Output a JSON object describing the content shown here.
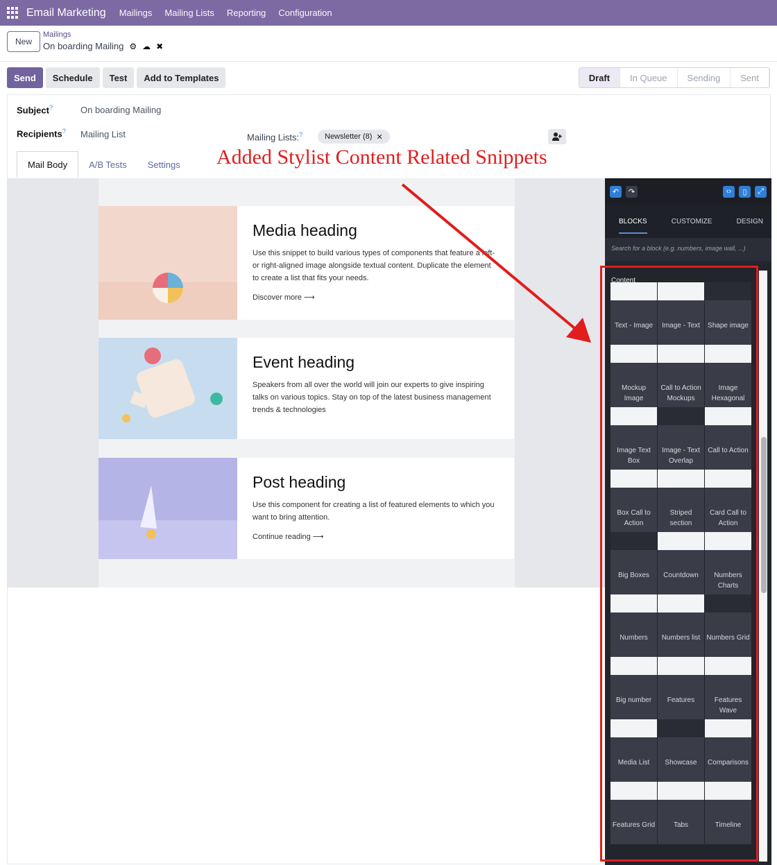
{
  "topnav": {
    "app_title": "Email Marketing",
    "items": [
      "Mailings",
      "Mailing Lists",
      "Reporting",
      "Configuration"
    ]
  },
  "control_panel": {
    "new_label": "New",
    "breadcrumb_parent": "Mailings",
    "breadcrumb_current": "On boarding Mailing",
    "gear_icon": "⚙",
    "upload_icon": "☁",
    "discard_icon": "✖"
  },
  "actions": {
    "send": "Send",
    "schedule": "Schedule",
    "test": "Test",
    "add_to_templates": "Add to Templates"
  },
  "stages": [
    "Draft",
    "In Queue",
    "Sending",
    "Sent"
  ],
  "form": {
    "subject_label": "Subject",
    "subject_value": "On boarding Mailing",
    "recipients_label": "Recipients",
    "recipients_value": "Mailing List",
    "mailing_lists_label": "Mailing Lists:",
    "help_mark": "?",
    "newsletter_tag": "Newsletter (8)",
    "tag_remove": "✕"
  },
  "tabs": [
    "Mail Body",
    "A/B Tests",
    "Settings"
  ],
  "annotation": "Added Stylist Content Related Snippets",
  "email": {
    "cards": [
      {
        "heading": "Media heading",
        "text": "Use this snippet to build various types of components that feature a left- or right-aligned image alongside textual content. Duplicate the element to create a list that fits your needs.",
        "link": "Discover more ⟶"
      },
      {
        "heading": "Event heading",
        "text": "Speakers from all over the world will join our experts to give inspiring talks on various topics. Stay on top of the latest business management trends & technologies",
        "link": ""
      },
      {
        "heading": "Post heading",
        "text": "Use this component for creating a list of featured elements to which you want to bring attention.",
        "link": "Continue reading ⟶"
      }
    ]
  },
  "sidebar": {
    "tabs": [
      "BLOCKS",
      "CUSTOMIZE",
      "DESIGN"
    ],
    "search_placeholder": "Search for a block (e.g. numbers, image wall, ...)",
    "section": "Content",
    "snippets": [
      "Text - Image",
      "Image - Text",
      "Shape image",
      "Mockup Image",
      "Call to Action Mockups",
      "Image Hexagonal",
      "Image Text Box",
      "Image - Text Overlap",
      "Call to Action",
      "Box Call to Action",
      "Striped section",
      "Card Call to Action",
      "Big Boxes",
      "Countdown",
      "Numbers Charts",
      "Numbers",
      "Numbers list",
      "Numbers Grid",
      "Big number",
      "Features",
      "Features Wave",
      "Media List",
      "Showcase",
      "Comparisons",
      "Features Grid",
      "Tabs",
      "Timeline"
    ]
  }
}
